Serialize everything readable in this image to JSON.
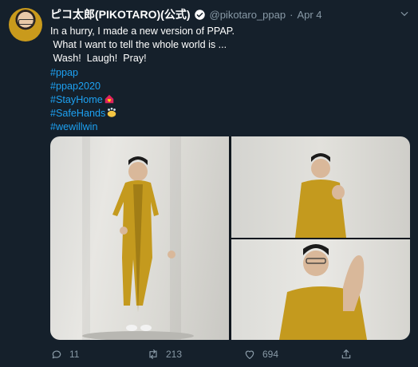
{
  "tweet": {
    "display_name": "ピコ太郎(PIKOTARO)(公式)",
    "handle": "@pikotaro_ppap",
    "separator": "·",
    "date": "Apr 4",
    "lines": [
      "In a hurry, I made a new version of PPAP.",
      " What I want to tell the whole world is ...",
      " Wash!  Laugh!  Pray!"
    ],
    "hashtags": [
      "#ppap",
      "#ppap2020",
      "#StayHome",
      "#SafeHands",
      "#wewillwin"
    ],
    "hashtag_emojis": {
      "#StayHome": "house-with-heart-icon",
      "#SafeHands": "washing-hands-icon"
    }
  },
  "media": {
    "photos": [
      "standing-full-body-photo",
      "hands-clasped-photo",
      "hands-pressed-closeup-photo"
    ]
  },
  "actions": {
    "reply_count": "11",
    "retweet_count": "213",
    "like_count": "694"
  },
  "colors": {
    "background": "#15202b",
    "accent": "#1da1f2",
    "muted": "#8899a6"
  }
}
